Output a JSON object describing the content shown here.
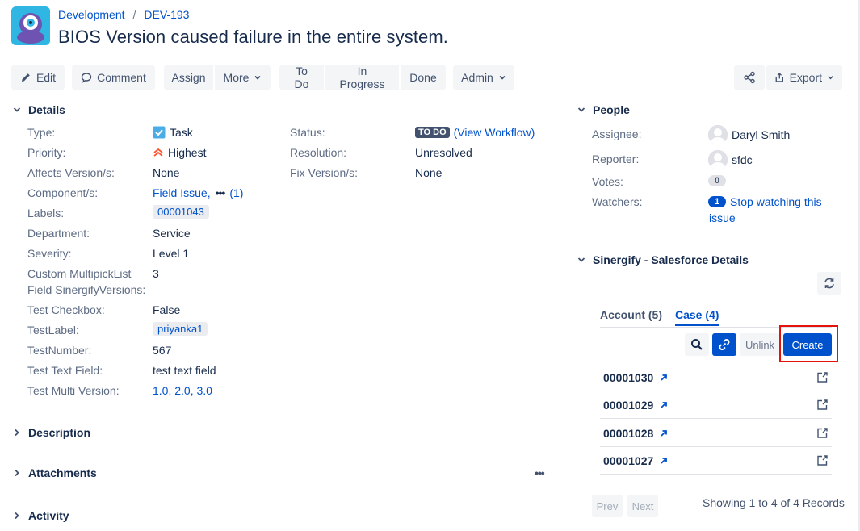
{
  "breadcrumb": {
    "project": "Development",
    "issue_key": "DEV-193"
  },
  "issue": {
    "title": "BIOS Version caused failure in the entire system."
  },
  "toolbar": {
    "edit": "Edit",
    "comment": "Comment",
    "assign": "Assign",
    "more": "More",
    "todo": "To Do",
    "in_progress": "In Progress",
    "done": "Done",
    "admin": "Admin",
    "export": "Export"
  },
  "details": {
    "heading": "Details",
    "type_label": "Type:",
    "type_value": "Task",
    "priority_label": "Priority:",
    "priority_value": "Highest",
    "affects_label": "Affects Version/s:",
    "affects_value": "None",
    "component_label": "Component/s:",
    "component_value": "Field Issue,",
    "component_more": "(1)",
    "labels_label": "Labels:",
    "labels_value": "00001043",
    "department_label": "Department:",
    "department_value": "Service",
    "severity_label": "Severity:",
    "severity_value": "Level 1",
    "custom_label_1": "Custom MultipickList",
    "custom_label_2": "Field SinergifyVersions:",
    "custom_value": "3",
    "checkbox_label": "Test Checkbox:",
    "checkbox_value": "False",
    "testlabel_label": "TestLabel:",
    "testlabel_value": "priyanka1",
    "testnumber_label": "TestNumber:",
    "testnumber_value": "567",
    "testtext_label": "Test Text Field:",
    "testtext_value": "test text field",
    "multiversion_label": "Test Multi Version:",
    "multiversion_value": "1.0, 2.0, 3.0",
    "status_label": "Status:",
    "status_value": "TO DO",
    "status_link": "(View Workflow)",
    "resolution_label": "Resolution:",
    "resolution_value": "Unresolved",
    "fixversion_label": "Fix Version/s:",
    "fixversion_value": "None"
  },
  "sections": {
    "description": "Description",
    "attachments": "Attachments",
    "activity": "Activity"
  },
  "people": {
    "heading": "People",
    "assignee_label": "Assignee:",
    "assignee_value": "Daryl Smith",
    "reporter_label": "Reporter:",
    "reporter_value": "sfdc",
    "votes_label": "Votes:",
    "votes_count": "0",
    "watchers_label": "Watchers:",
    "watchers_count": "1",
    "watch_link_1": "Stop watching this",
    "watch_link_2": "issue"
  },
  "salesforce": {
    "heading": "Sinergify - Salesforce Details",
    "tab_account": "Account (5)",
    "tab_case": "Case (4)",
    "unlink": "Unlink",
    "create": "Create",
    "cases": [
      "00001030",
      "00001029",
      "00001028",
      "00001027"
    ],
    "prev": "Prev",
    "next": "Next",
    "showing": "Showing 1 to 4 of 4 Records",
    "highlight_color": "#e3120b"
  }
}
